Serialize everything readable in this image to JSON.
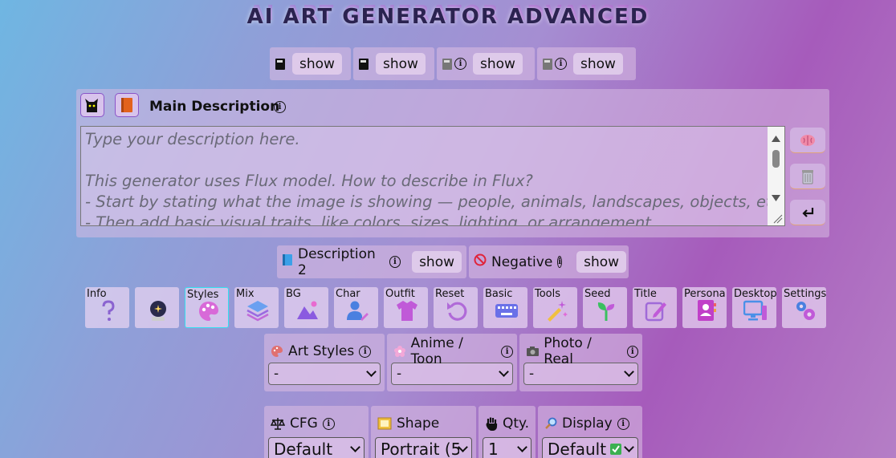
{
  "app_title": "AI ART GENERATOR ADVANCED",
  "show_bar": [
    {
      "icon": "book-icon",
      "label": "show"
    },
    {
      "icon": "book-icon",
      "label": "show"
    },
    {
      "icon": "book-gray-icon",
      "label": "show"
    },
    {
      "icon": "book-gray-icon",
      "label": "show"
    }
  ],
  "main": {
    "title": "Main Description",
    "placeholder_lines": [
      "Type your description here.",
      "",
      "This generator uses Flux model. How to describe in Flux?",
      "- Start by stating what the image is showing — people, animals, landscapes, objects, etc.",
      "- Then add basic visual traits, like colors, sizes, lighting, or arrangement."
    ]
  },
  "desc2": {
    "label": "Description 2",
    "show": "show"
  },
  "negative": {
    "label": "Negative",
    "show": "show"
  },
  "tools": [
    {
      "label": "Info",
      "icon": "question-icon"
    },
    {
      "label": "",
      "icon": "crystal-ball-icon"
    },
    {
      "label": "Styles",
      "icon": "palette-icon",
      "active": true
    },
    {
      "label": "Mix",
      "icon": "layers-icon"
    },
    {
      "label": "BG",
      "icon": "landscape-icon"
    },
    {
      "label": "Char",
      "icon": "user-edit-icon"
    },
    {
      "label": "Outfit",
      "icon": "shirt-icon"
    },
    {
      "label": "Reset",
      "icon": "undo-icon"
    },
    {
      "label": "Basic",
      "icon": "keyboard-icon"
    },
    {
      "label": "Tools",
      "icon": "magic-wand-icon"
    },
    {
      "label": "Seed",
      "icon": "sprout-icon"
    },
    {
      "label": "Title",
      "icon": "edit-icon"
    },
    {
      "label": "Persona",
      "icon": "contact-book-icon"
    },
    {
      "label": "Desktop",
      "icon": "desktop-icon"
    },
    {
      "label": "Settings",
      "icon": "gears-icon"
    }
  ],
  "selects": [
    {
      "label": "Art Styles",
      "value": "-",
      "icon": "palette-icon"
    },
    {
      "label": "Anime / Toon",
      "value": "-",
      "icon": "blossom-icon"
    },
    {
      "label": "Photo / Real",
      "value": "-",
      "icon": "camera-icon"
    }
  ],
  "bottom": [
    {
      "label": "CFG",
      "value": "Default",
      "icon": "scales-icon"
    },
    {
      "label": "Shape",
      "value": "Portrait (5",
      "icon": "frame-icon"
    },
    {
      "label": "Qty.",
      "value": "1",
      "icon": "hand-icon"
    },
    {
      "label": "Display",
      "value": "Default",
      "icon": "magnifier-icon"
    }
  ]
}
